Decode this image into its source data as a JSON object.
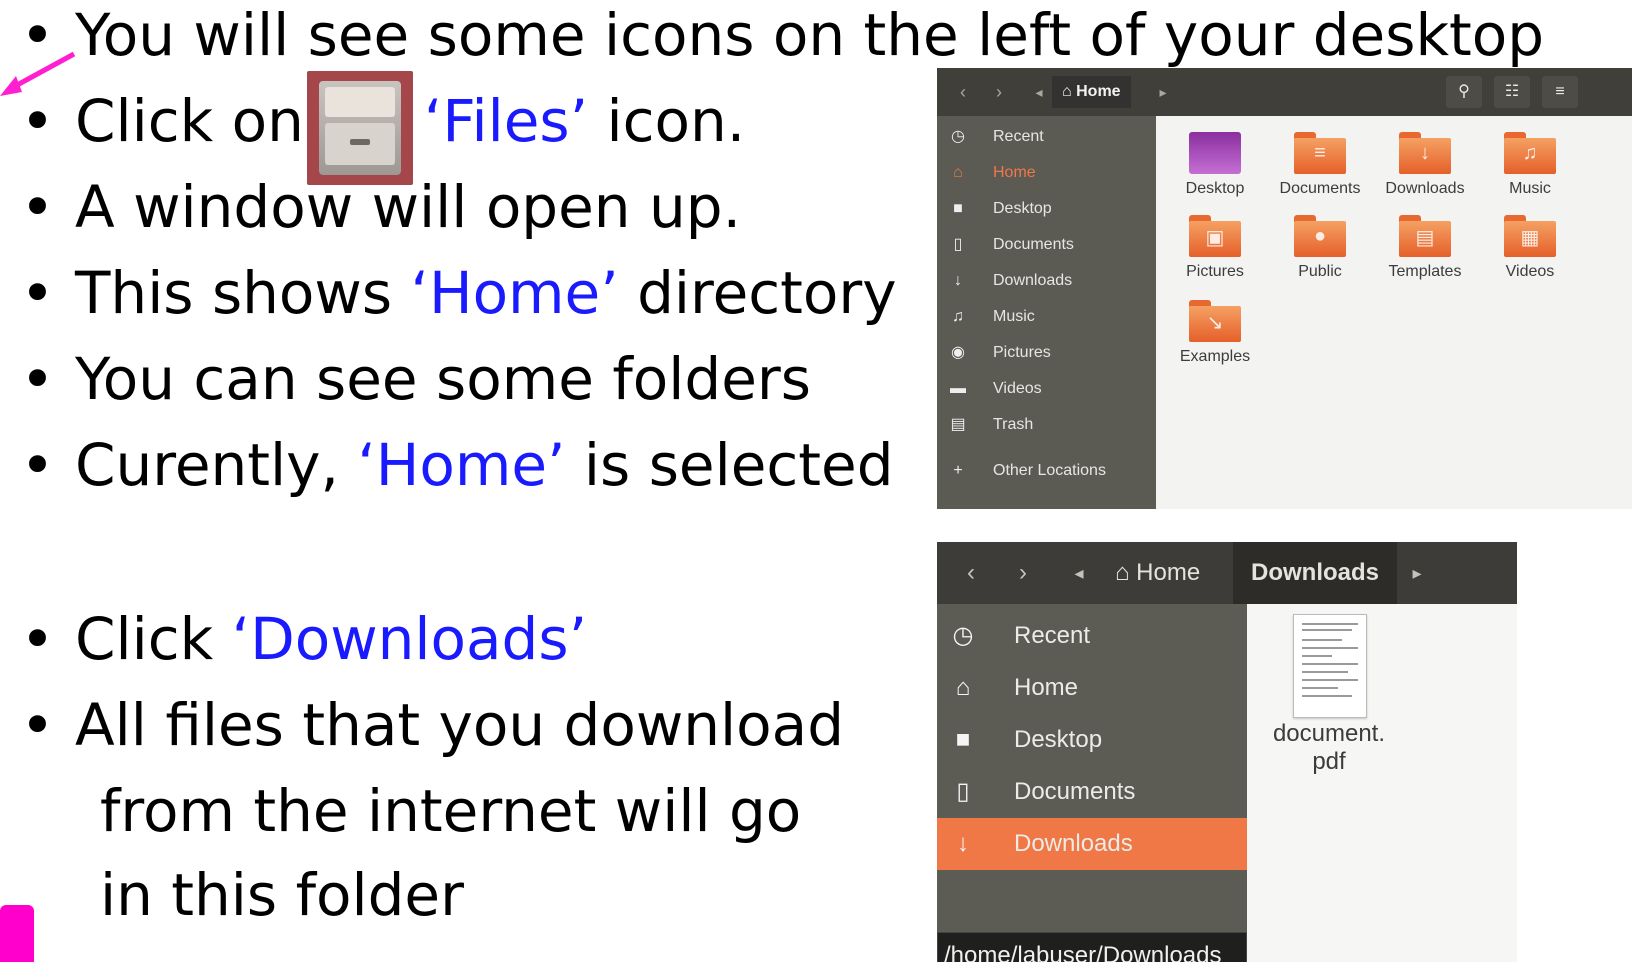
{
  "bullets": {
    "b1": "You will see some icons on the left of your desktop",
    "b2_pre": "Click on",
    "b2_blue": "‘Files’",
    "b2_post": "icon.",
    "b3": "A window will open up.",
    "b4_pre": "This shows",
    "b4_blue": "‘Home’",
    "b4_post": "directory",
    "b5": "You can see some folders",
    "b6_pre": "Curently,",
    "b6_blue": "‘Home’",
    "b6_post": "is selected",
    "b7_pre": "Click",
    "b7_blue": "‘Downloads’",
    "b8": "All files that you download",
    "b9": "from the internet will go",
    "b10": "in this folder",
    "dot": "•"
  },
  "window1": {
    "breadcrumb": "Home",
    "back_icon": "‹",
    "fwd_icon": "›",
    "sidebar": [
      {
        "icon": "clock-icon",
        "glyph": "◷",
        "label": "Recent"
      },
      {
        "icon": "home-icon",
        "glyph": "⌂",
        "label": "Home"
      },
      {
        "icon": "folder-icon",
        "glyph": "■",
        "label": "Desktop"
      },
      {
        "icon": "document-icon",
        "glyph": "▯",
        "label": "Documents"
      },
      {
        "icon": "download-icon",
        "glyph": "↓",
        "label": "Downloads"
      },
      {
        "icon": "music-icon",
        "glyph": "♫",
        "label": "Music"
      },
      {
        "icon": "camera-icon",
        "glyph": "◉",
        "label": "Pictures"
      },
      {
        "icon": "video-icon",
        "glyph": "▬",
        "label": "Videos"
      },
      {
        "icon": "trash-icon",
        "glyph": "▤",
        "label": "Trash"
      },
      {
        "icon": "plus-icon",
        "glyph": "+",
        "label": "Other Locations"
      }
    ],
    "folders": [
      {
        "label": "Desktop",
        "glyph": ""
      },
      {
        "label": "Documents",
        "glyph": "≡"
      },
      {
        "label": "Downloads",
        "glyph": "↓"
      },
      {
        "label": "Music",
        "glyph": "♫"
      },
      {
        "label": "Pictures",
        "glyph": "▣"
      },
      {
        "label": "Public",
        "glyph": "●"
      },
      {
        "label": "Templates",
        "glyph": "▤"
      },
      {
        "label": "Videos",
        "glyph": "▦"
      },
      {
        "label": "Examples",
        "glyph": "↘"
      }
    ],
    "active_item": "Home",
    "colors": {
      "accent": "#f0784a",
      "sidebar": "#5b5a53",
      "header": "#403f3a"
    }
  },
  "window2": {
    "breadcrumb_home": "Home",
    "breadcrumb_current": "Downloads",
    "back_icon": "‹",
    "fwd_icon": "›",
    "sidebar": [
      {
        "icon": "clock-icon",
        "glyph": "◷",
        "label": "Recent"
      },
      {
        "icon": "home-icon",
        "glyph": "⌂",
        "label": "Home"
      },
      {
        "icon": "folder-icon",
        "glyph": "■",
        "label": "Desktop"
      },
      {
        "icon": "document-icon",
        "glyph": "▯",
        "label": "Documents"
      },
      {
        "icon": "download-icon",
        "glyph": "↓",
        "label": "Downloads"
      }
    ],
    "tooltip": "/home/labuser/Downloads",
    "file_label_1": "document.",
    "file_label_2": "pdf",
    "active_item": "Downloads",
    "colors": {
      "accent": "#f07746",
      "sidebar": "#5c5b54",
      "header": "#3d3c38"
    }
  }
}
